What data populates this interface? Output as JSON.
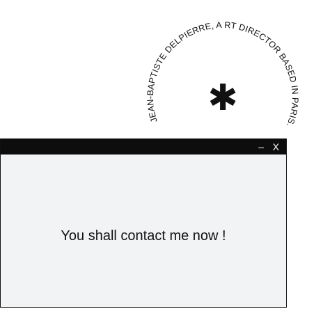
{
  "badge": {
    "circular_text": "JEAN-BAPTISTE DELPIERRE, A RT DIRECTOR BASED IN PARIS.",
    "center_icon": "asterisk-icon",
    "center_glyph": "✱"
  },
  "window": {
    "minimize_label": "–",
    "close_label": "X",
    "message": "You shall contact me now !"
  },
  "colors": {
    "titlebar": "#0d0d0d",
    "window_bg": "#f2f3f5",
    "text": "#111111"
  }
}
